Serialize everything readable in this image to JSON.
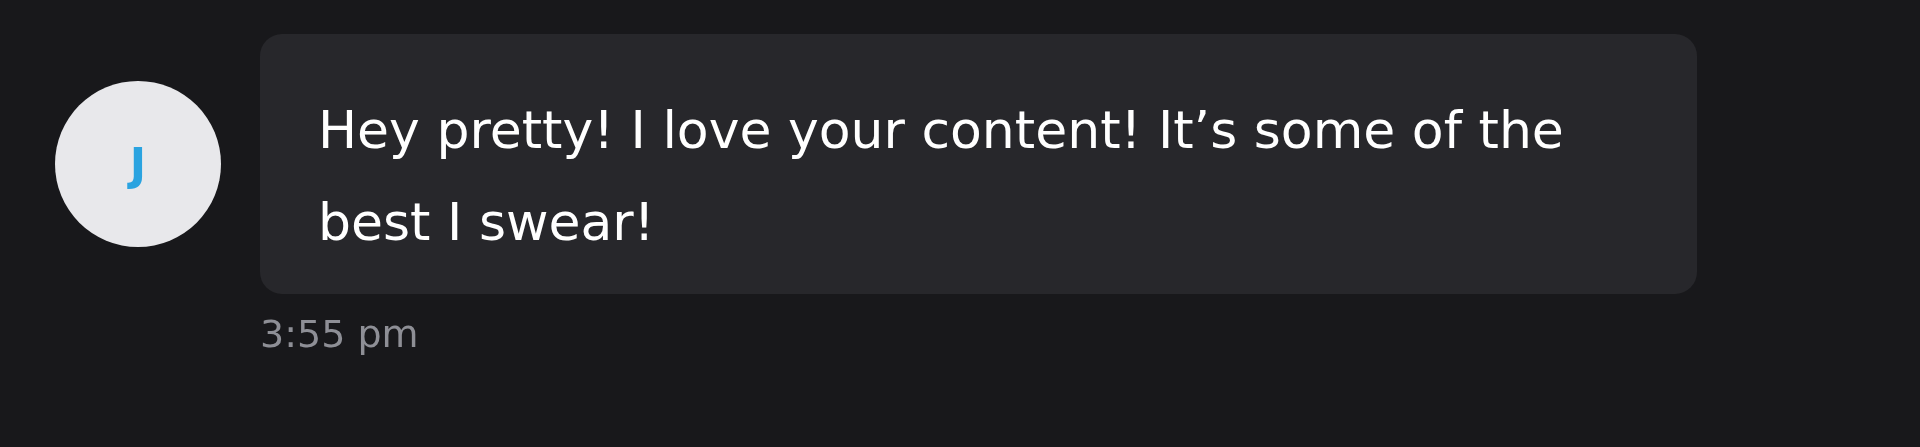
{
  "message": {
    "avatar_initial": "J",
    "text": "Hey pretty! I love your content! It’s some of the best I swear!",
    "time": "3:55 pm"
  }
}
